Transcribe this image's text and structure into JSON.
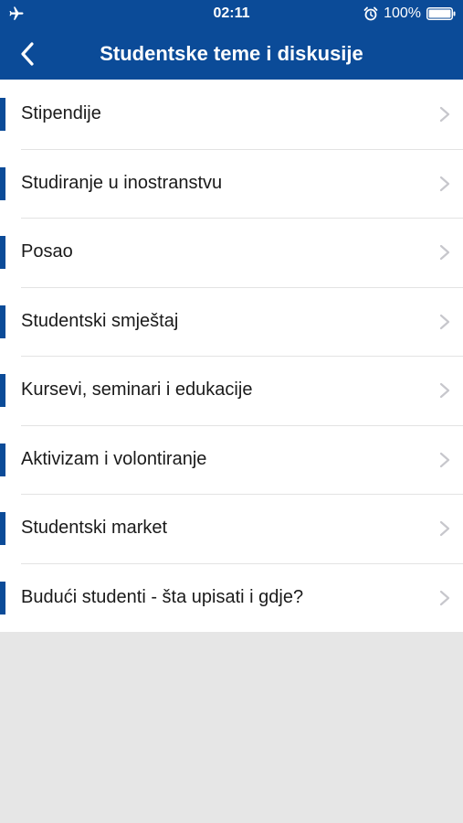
{
  "status_bar": {
    "time": "02:11",
    "battery": "100%",
    "icons": [
      "airplane-icon",
      "alarm-icon",
      "battery-icon"
    ]
  },
  "nav": {
    "title": "Studentske teme i diskusije",
    "back_icon": "chevron-left-icon"
  },
  "colors": {
    "header": "#0b4b98",
    "accent": "#0b4b98",
    "background": "#e6e6e6",
    "chevron": "#c7c7cc"
  },
  "list": {
    "items": [
      {
        "label": "Stipendije"
      },
      {
        "label": "Studiranje u inostranstvu"
      },
      {
        "label": "Posao"
      },
      {
        "label": "Studentski smještaj"
      },
      {
        "label": "Kursevi, seminari i edukacije"
      },
      {
        "label": "Aktivizam i volontiranje"
      },
      {
        "label": "Studentski market"
      },
      {
        "label": "Budući studenti - šta upisati i gdje?"
      }
    ]
  }
}
